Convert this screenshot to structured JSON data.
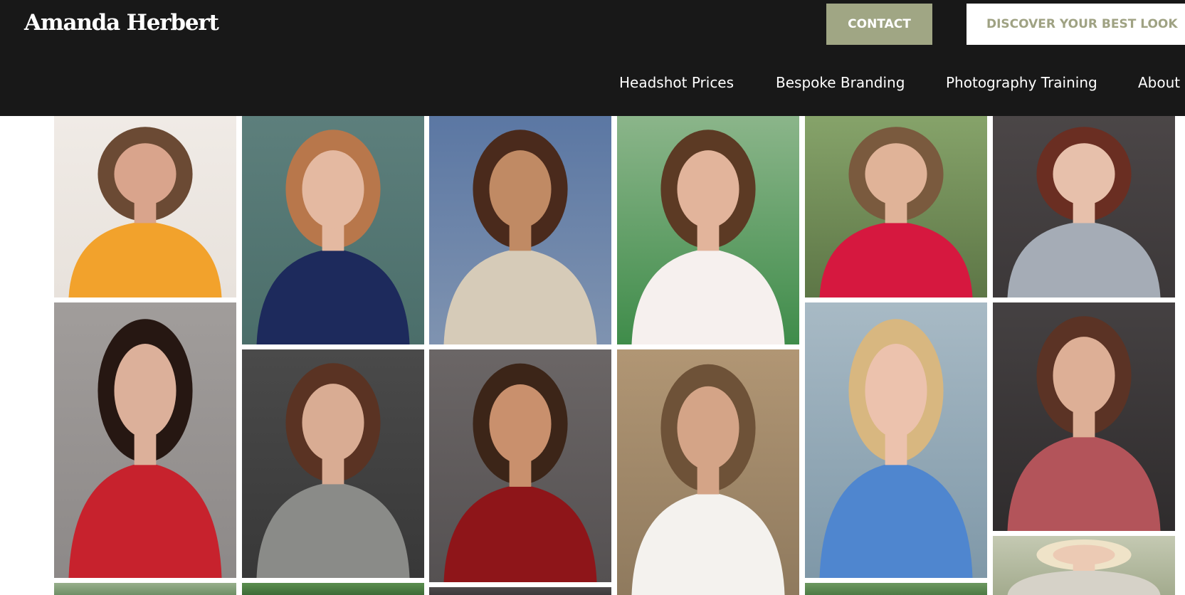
{
  "header": {
    "logo": "Amanda Herbert",
    "contact_button": "CONTACT",
    "discover_button": "DISCOVER YOUR BEST LOOK",
    "nav": [
      {
        "label": "Headshot Prices"
      },
      {
        "label": "Bespoke Branding"
      },
      {
        "label": "Photography Training"
      },
      {
        "label": "About"
      }
    ]
  },
  "colors": {
    "header_bg": "#181818",
    "accent": "#a0a684",
    "page_bg": "#ffffff"
  },
  "gallery": {
    "photos": [
      {
        "icon": "portrait-photo",
        "bg": "#e8e2dc",
        "top": "#f0ebe6",
        "bottom": "#f2a22c",
        "skin": "#d9a48c",
        "hair": "#6b4a34",
        "subject": "man-orange-hoodie"
      },
      {
        "icon": "portrait-photo",
        "bg": "#4b6e6a",
        "top": "#5d7f7c",
        "bottom": "#1d2a5c",
        "skin": "#e4b9a1",
        "hair": "#b8774b",
        "subject": "young-man-navy-shirt"
      },
      {
        "icon": "portrait-photo",
        "bg": "#7f93b0",
        "top": "#5b77a3",
        "bottom": "#d6cbb8",
        "skin": "#c08a64",
        "hair": "#4a2a1c",
        "subject": "woman-gold-gown-beach"
      },
      {
        "icon": "portrait-photo",
        "bg": "#3f8c4a",
        "top": "#8bb58a",
        "bottom": "#f6f0ee",
        "skin": "#e2b49b",
        "hair": "#5c3a24",
        "subject": "girl-white-top-green"
      },
      {
        "icon": "portrait-photo",
        "bg": "#5d7646",
        "top": "#86a36a",
        "bottom": "#d6183f",
        "skin": "#e0b398",
        "hair": "#7a5a3e",
        "subject": "woman-red-dress"
      },
      {
        "icon": "portrait-photo",
        "bg": "#3c3839",
        "top": "#4b4647",
        "bottom": "#a5acb6",
        "skin": "#e7c0ab",
        "hair": "#6a2e22",
        "subject": "woman-grey-sweater"
      },
      {
        "icon": "portrait-photo",
        "bg": "#8d8988",
        "top": "#a19d9b",
        "bottom": "#c7222d",
        "skin": "#dcb09a",
        "hair": "#261712",
        "subject": "girl-curly-red-top"
      },
      {
        "icon": "portrait-photo",
        "bg": "#383838",
        "top": "#4a4a4a",
        "bottom": "#8a8b88",
        "skin": "#d9ac93",
        "hair": "#5a3323",
        "subject": "woman-grey-tshirt"
      },
      {
        "icon": "portrait-photo",
        "bg": "#555152",
        "top": "#6b6666",
        "bottom": "#8e1519",
        "skin": "#c9906d",
        "hair": "#3c2518",
        "subject": "woman-red-sweater"
      },
      {
        "icon": "portrait-photo",
        "bg": "#8f7a5e",
        "top": "#b19674",
        "bottom": "#f4f2ee",
        "skin": "#d4a487",
        "hair": "#6e5238",
        "subject": "woman-white-tank"
      },
      {
        "icon": "portrait-photo",
        "bg": "#7f98a8",
        "top": "#a8bac5",
        "bottom": "#4f86cf",
        "skin": "#ecc2ad",
        "hair": "#d8b780",
        "subject": "woman-blue-sweater"
      },
      {
        "icon": "portrait-photo",
        "bg": "#2f2c2d",
        "top": "#454142",
        "bottom": "#b3545a",
        "skin": "#ddaf96",
        "hair": "#5b3325",
        "subject": "woman-pink-blouse"
      },
      {
        "icon": "portrait-photo",
        "bg": "#6f8f66",
        "top": "#98af8c",
        "bottom": "#6a7a62",
        "skin": "#e4bea8",
        "hair": "#4a3a2c",
        "subject": "partial-row-1"
      },
      {
        "icon": "portrait-photo",
        "bg": "#3d6b37",
        "top": "#5b8e4f",
        "bottom": "#2b4a27",
        "skin": "#c99c80",
        "hair": "#3a2a1f",
        "subject": "partial-row-2"
      },
      {
        "icon": "portrait-photo",
        "bg": "#3d3a3b",
        "top": "#4e4a4b",
        "bottom": "#2f2c2d",
        "skin": "#c9906d",
        "hair": "#3c2518",
        "subject": "partial-row-3"
      },
      {
        "icon": "portrait-photo",
        "bg": "#4d7a45",
        "top": "#6c9860",
        "bottom": "#3a5e33",
        "skin": "#c99c80",
        "hair": "#3a2a1f",
        "subject": "partial-row-5"
      },
      {
        "icon": "portrait-photo",
        "bg": "#a3ab8e",
        "top": "#c4c9b2",
        "bottom": "#d6d2c8",
        "skin": "#eccab4",
        "hair": "#efe3c8",
        "subject": "woman-blonde-partial"
      }
    ]
  }
}
